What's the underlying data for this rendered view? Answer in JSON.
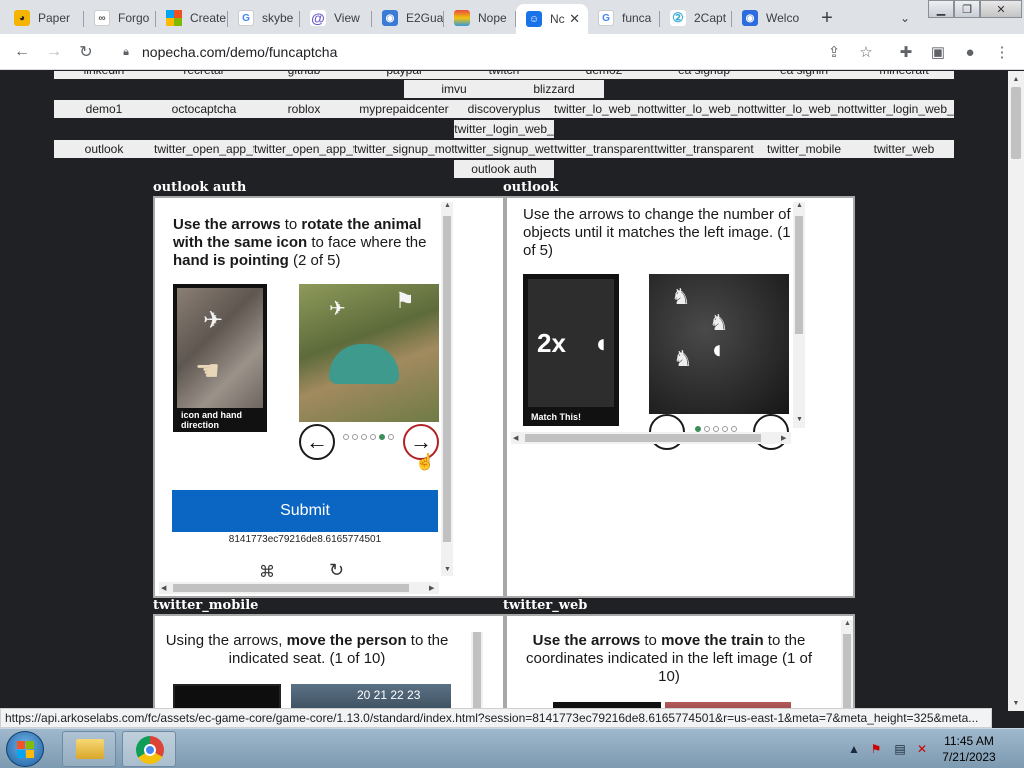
{
  "browser": {
    "tabs": [
      {
        "title": "Paper",
        "favicon": "pac-icon",
        "color": "#f5b400"
      },
      {
        "title": "Forgo",
        "favicon": "infinity-icon",
        "color": "#666666"
      },
      {
        "title": "Create",
        "favicon": "microsoft-icon",
        "color": "#f25022"
      },
      {
        "title": "skybe",
        "favicon": "google-icon",
        "color": "#4285f4"
      },
      {
        "title": "View",
        "favicon": "at-icon",
        "color": "#6a5acd"
      },
      {
        "title": "E2Gua",
        "favicon": "globe-icon",
        "color": "#3a7bd5"
      },
      {
        "title": "Nope",
        "favicon": "rainbow-icon",
        "color": "#e74c3c"
      },
      {
        "title": "Nc",
        "favicon": "robot-icon",
        "color": "#1a73e8"
      },
      {
        "title": "funca",
        "favicon": "google-icon",
        "color": "#4285f4"
      },
      {
        "title": "2Capt",
        "favicon": "captcha-icon",
        "color": "#3aaed8"
      },
      {
        "title": "Welco",
        "favicon": "globe-icon",
        "color": "#2d6cdf"
      }
    ],
    "url": "nopecha.com/demo/funcaptcha",
    "status_url": "https://api.arkoselabs.com/fc/assets/ec-game-core/game-core/1.13.0/standard/index.html?session=8141773ec79216de8.6165774501&r=us-east-1&meta=7&meta_height=325&meta..."
  },
  "nav": {
    "row0": [
      "linkedin",
      "recretar",
      "github",
      "paypal",
      "twitch",
      "demo2",
      "ea signup",
      "ea signin",
      "minecraft"
    ],
    "imvu": "imvu",
    "blizzard": "blizzard",
    "row1": [
      "demo1",
      "octocaptcha",
      "roblox",
      "myprepaidcenter",
      "discoveryplus",
      "twitter_lo_web_not",
      "twitter_lo_web_not",
      "twitter_lo_web_not",
      "twitter_login_web_"
    ],
    "mid": "twitter_login_web_",
    "row2": [
      "outlook",
      "twitter_open_app_f",
      "twitter_open_app_f",
      "twitter_signup_mot",
      "twitter_signup_wet",
      "twitter_transparent",
      "twitter_transparent",
      "twitter_mobile",
      "twitter_web"
    ],
    "outlook_auth_box": "outlook auth"
  },
  "sections": {
    "outlook_auth": "outlook auth",
    "outlook": "outlook",
    "twitter_mobile": "twitter_mobile",
    "twitter_web": "twitter_web"
  },
  "captcha1": {
    "instr_1": "Use the arrows",
    "instr_2": " to ",
    "instr_3": "rotate the animal with the same icon",
    "instr_4": " to face where the ",
    "instr_5": "hand is pointing",
    "instr_6": " (2 of 5)",
    "label": "icon and hand direction",
    "submit": "Submit",
    "session": "8141773ec79216de8.6165774501",
    "progress": "2 of 5"
  },
  "captcha2": {
    "instr": "Use the arrows to change the number of objects until it matches the left image. (1 of 5)",
    "count": "2x",
    "label": "Match This!"
  },
  "captcha3": {
    "instr_1": "Using the arrows, ",
    "instr_2": "move the person",
    "instr_3": " to the indicated seat. (1 of 10)",
    "seats": "20 21 22 23"
  },
  "captcha4": {
    "instr_1": "Use the arrows",
    "instr_2": " to ",
    "instr_3": "move the train",
    "instr_4": " to the coordinates indicated in the left image (1 of 10)"
  },
  "taskbar": {
    "time": "11:45 AM",
    "date": "7/21/2023"
  }
}
